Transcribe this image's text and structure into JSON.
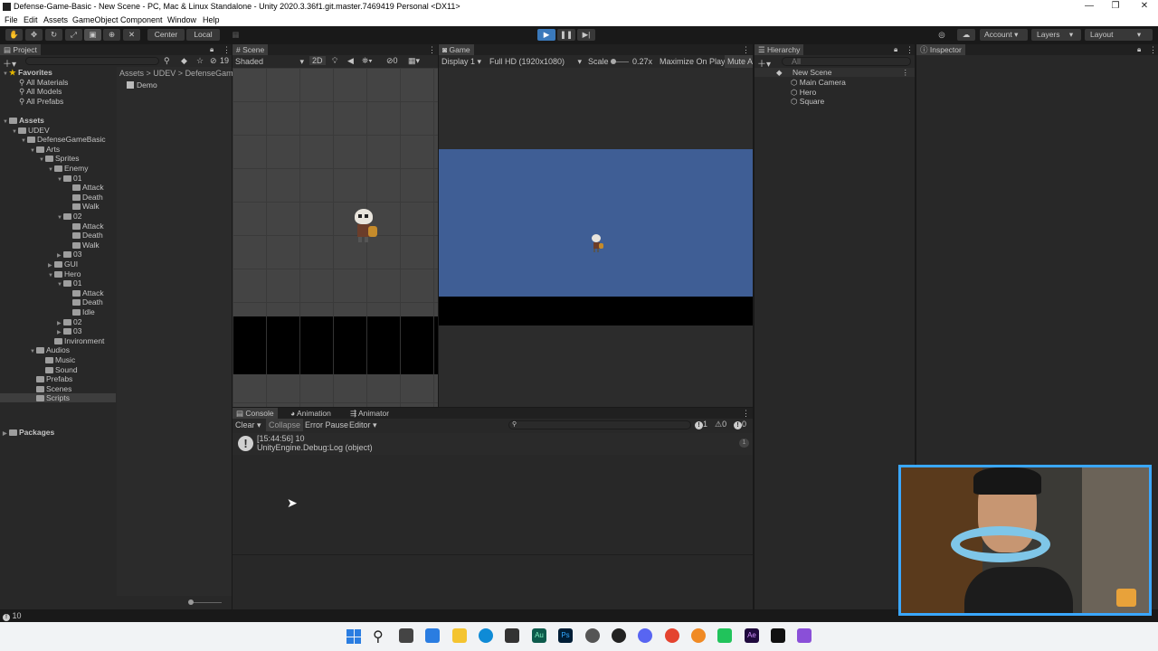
{
  "window": {
    "title": "Defense-Game-Basic - New Scene - PC, Mac & Linux Standalone - Unity 2020.3.36f1.git.master.7469419 Personal <DX11>",
    "minimize": "—",
    "maximize": "❐",
    "close": "✕"
  },
  "menu": [
    "File",
    "Edit",
    "Assets",
    "GameObject",
    "Component",
    "Window",
    "Help"
  ],
  "toolbar": {
    "center": "Center",
    "local": "Local",
    "account": "Account",
    "layers": "Layers",
    "layout": "Layout"
  },
  "project": {
    "tab": "Project",
    "count": "19",
    "breadcrumb": [
      "Assets",
      "UDEV",
      "DefenseGame"
    ],
    "favorites_label": "Favorites",
    "favorites": [
      "All Materials",
      "All Models",
      "All Prefabs"
    ],
    "tree": [
      {
        "label": "Assets",
        "level": 0,
        "bold": true
      },
      {
        "label": "UDEV",
        "level": 1
      },
      {
        "label": "DefenseGameBasic",
        "level": 2
      },
      {
        "label": "Arts",
        "level": 3
      },
      {
        "label": "Sprites",
        "level": 4
      },
      {
        "label": "Enemy",
        "level": 5
      },
      {
        "label": "01",
        "level": 6
      },
      {
        "label": "Attack",
        "level": 7
      },
      {
        "label": "Death",
        "level": 7
      },
      {
        "label": "Walk",
        "level": 7
      },
      {
        "label": "02",
        "level": 6
      },
      {
        "label": "Attack",
        "level": 7
      },
      {
        "label": "Death",
        "level": 7
      },
      {
        "label": "Walk",
        "level": 7
      },
      {
        "label": "03",
        "level": 6
      },
      {
        "label": "GUI",
        "level": 5
      },
      {
        "label": "Hero",
        "level": 5
      },
      {
        "label": "01",
        "level": 6
      },
      {
        "label": "Attack",
        "level": 7
      },
      {
        "label": "Death",
        "level": 7
      },
      {
        "label": "Idle",
        "level": 7
      },
      {
        "label": "02",
        "level": 6
      },
      {
        "label": "03",
        "level": 6
      },
      {
        "label": "Invironment",
        "level": 5
      },
      {
        "label": "Audios",
        "level": 3
      },
      {
        "label": "Music",
        "level": 4
      },
      {
        "label": "Sound",
        "level": 4
      },
      {
        "label": "Prefabs",
        "level": 3
      },
      {
        "label": "Scenes",
        "level": 3
      },
      {
        "label": "Scripts",
        "level": 3,
        "selected": true
      }
    ],
    "packages": "Packages",
    "content": [
      "Demo"
    ]
  },
  "scene": {
    "tab": "Scene",
    "shading": "Shaded",
    "mode2d": "2D",
    "hidden_count": "0"
  },
  "game": {
    "tab": "Game",
    "display": "Display 1",
    "resolution": "Full HD (1920x1080)",
    "scale_label": "Scale",
    "scale_value": "0.27x",
    "maximize": "Maximize On Play",
    "mute": "Mute A"
  },
  "hierarchy": {
    "tab": "Hierarchy",
    "search": "All",
    "scene": "New Scene",
    "items": [
      "Main Camera",
      "Hero",
      "Square"
    ]
  },
  "inspector": {
    "tab": "Inspector"
  },
  "console": {
    "tabs": [
      "Console",
      "Animation",
      "Animator"
    ],
    "clear": "Clear",
    "collapse": "Collapse",
    "error_pause": "Error Pause",
    "editor": "Editor",
    "log_count": "1",
    "warn_count": "0",
    "error_count": "0",
    "entry_line1": "[15:44:56] 10",
    "entry_line2": "UnityEngine.Debug:Log (object)",
    "entry_count": "1"
  },
  "statusbar": {
    "text": "10"
  },
  "colors": {
    "game_bg": "#3f5e95",
    "accent": "#3a79bb"
  }
}
